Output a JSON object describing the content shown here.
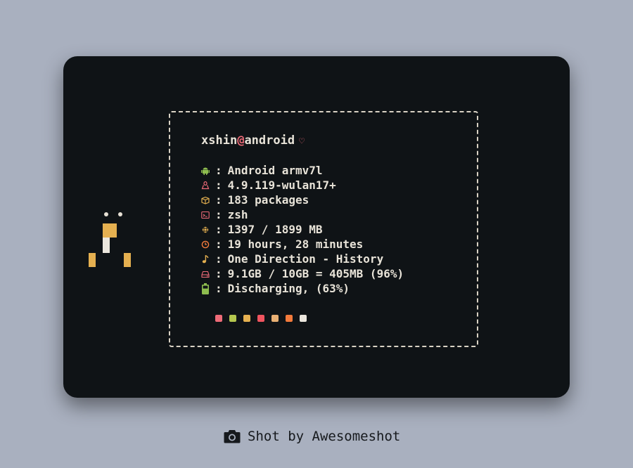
{
  "terminal": {
    "user": "xshin",
    "at": "@",
    "host": "android",
    "heart": "♡",
    "separator": ":",
    "rows": [
      {
        "icon": "android-icon",
        "color": "#8ebd4f",
        "value": "Android armv7l"
      },
      {
        "icon": "linux-tux-icon",
        "color": "#ee6b78",
        "value": "4.9.119-wulan17+"
      },
      {
        "icon": "package-icon",
        "color": "#e5b050",
        "value": "183 packages"
      },
      {
        "icon": "terminal-icon",
        "color": "#ee6b78",
        "value": "zsh"
      },
      {
        "icon": "memory-chip-icon",
        "color": "#e5b050",
        "value": "1397 / 1899 MB"
      },
      {
        "icon": "clock-icon",
        "color": "#f37b3c",
        "value": "19 hours, 28 minutes"
      },
      {
        "icon": "music-note-icon",
        "color": "#e5b050",
        "value": "One Direction - History"
      },
      {
        "icon": "hard-drive-icon",
        "color": "#ee6b78",
        "value": "9.1GB / 10GB = 405MB (96%)"
      },
      {
        "icon": "battery-icon",
        "color": "#8ebd4f",
        "value": "Discharging, (63%)"
      }
    ],
    "palette": [
      "#ee6b78",
      "#b5c74f",
      "#e5b050",
      "#f0545f",
      "#e9b074",
      "#f37b3c",
      "#ece7de"
    ]
  },
  "footer": {
    "icon": "camera-icon",
    "label": "Shot by Awesomeshot"
  }
}
